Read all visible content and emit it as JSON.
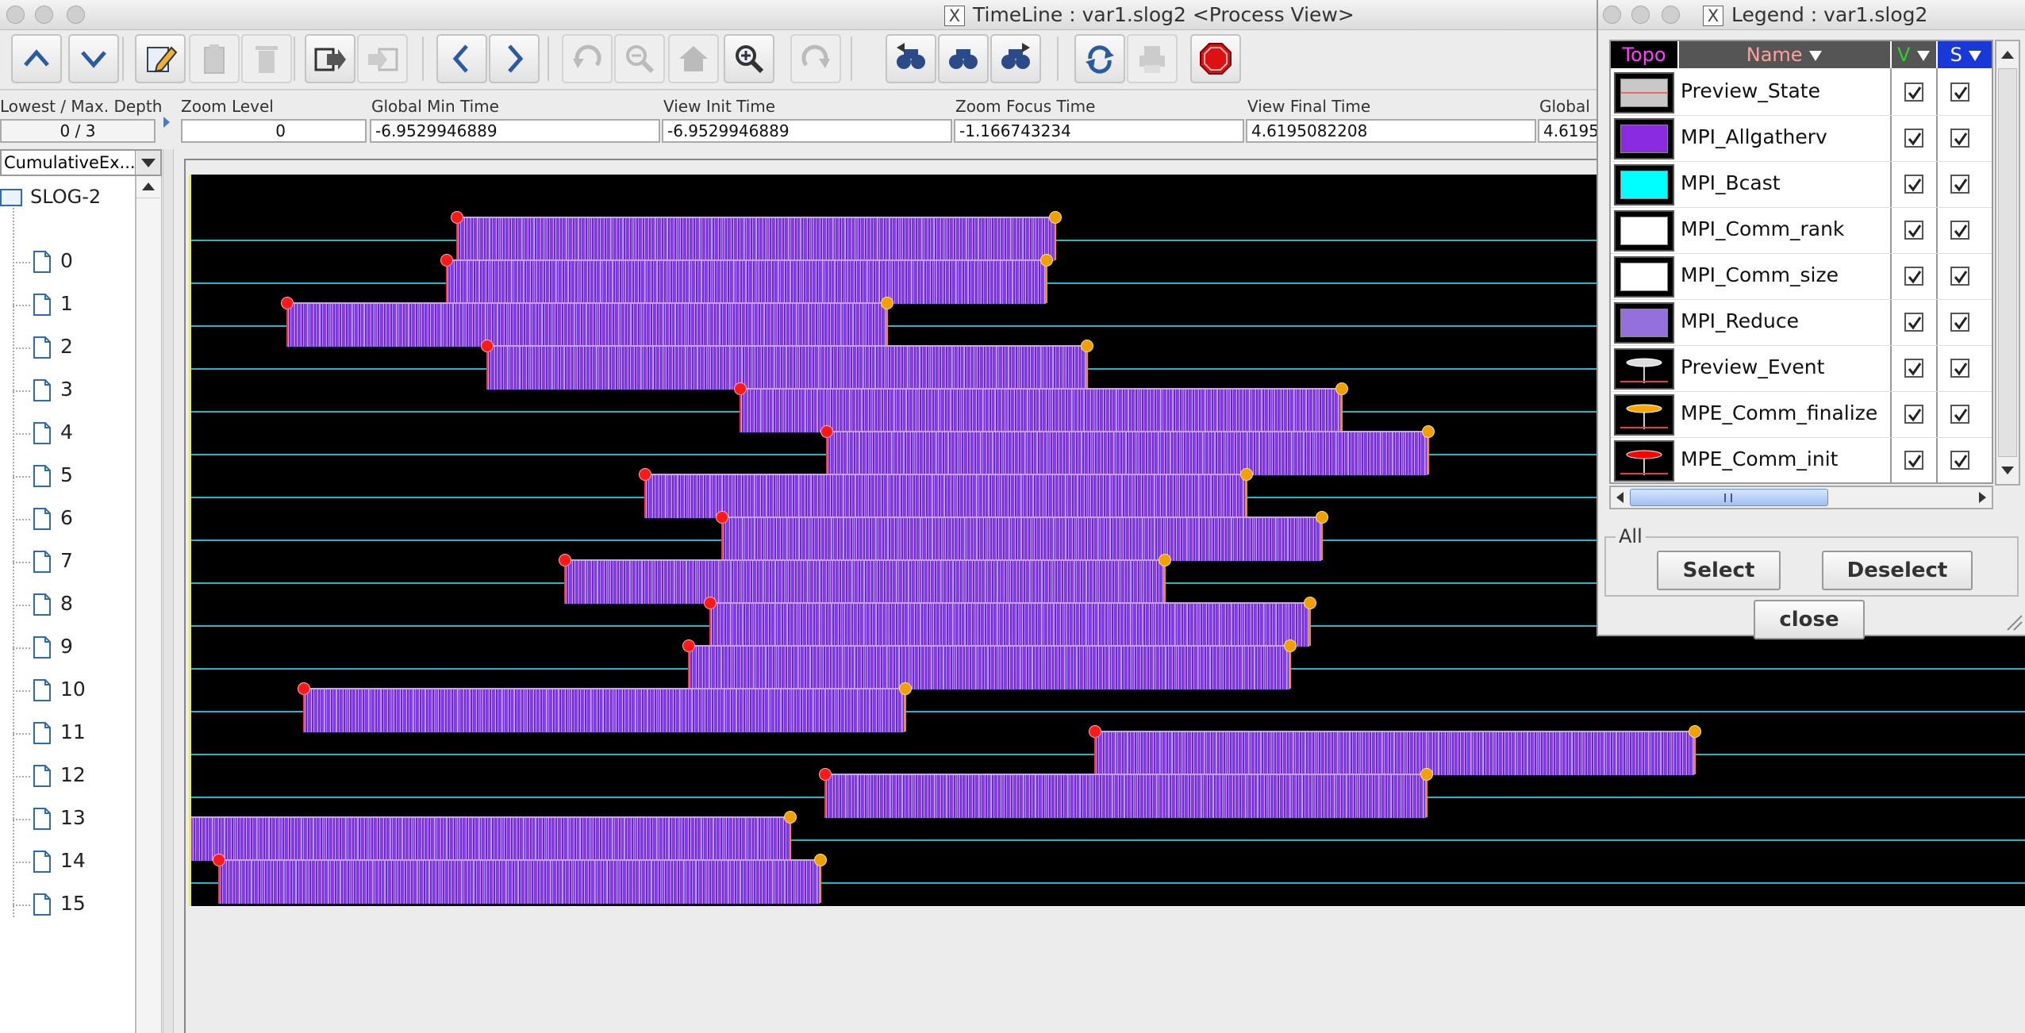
{
  "window": {
    "title": "TimeLine : var1.slog2  <Process View>"
  },
  "toolbar": {
    "buttons": [
      {
        "icon": "chevron-up-icon"
      },
      {
        "icon": "chevron-down-icon"
      },
      {
        "icon": "edit-pencil-icon"
      },
      {
        "icon": "clipboard-icon"
      },
      {
        "icon": "trash-icon"
      },
      {
        "icon": "export-icon"
      },
      {
        "icon": "import-icon"
      },
      {
        "icon": "chevron-left-icon"
      },
      {
        "icon": "chevron-right-icon"
      },
      {
        "icon": "undo-icon"
      },
      {
        "icon": "zoom-out-icon"
      },
      {
        "icon": "home-icon"
      },
      {
        "icon": "zoom-in-icon"
      },
      {
        "icon": "redo-icon"
      },
      {
        "icon": "search-backward-icon"
      },
      {
        "icon": "binoculars-icon"
      },
      {
        "icon": "search-forward-icon"
      },
      {
        "icon": "refresh-icon"
      },
      {
        "icon": "print-icon"
      },
      {
        "icon": "stop-icon"
      }
    ]
  },
  "fields": {
    "depth_label": "Lowest / Max. Depth",
    "depth_value": "0 / 3",
    "zoom_label": "Zoom Level",
    "zoom_value": "0",
    "global_min_label": "Global Min Time",
    "global_min_value": "-6.9529946889",
    "view_init_label": "View  Init Time",
    "view_init_value": "-6.9529946889",
    "zoom_focus_label": "Zoom Focus Time",
    "zoom_focus_value": "-1.166743234",
    "view_final_label": "View Final Time",
    "view_final_value": "4.6195082208",
    "global_max_label": "Global M",
    "global_max_value": "4.6195"
  },
  "combo": {
    "value": "CumulativeEx..."
  },
  "tree": {
    "root": "SLOG-2",
    "items": [
      "0",
      "1",
      "2",
      "3",
      "4",
      "5",
      "6",
      "7",
      "8",
      "9",
      "10",
      "11",
      "12",
      "13",
      "14",
      "15"
    ]
  },
  "timeline": {
    "rows": [
      {
        "rank": 0,
        "start": 0.159,
        "end": 0.518
      },
      {
        "rank": 1,
        "start": 0.153,
        "end": 0.513
      },
      {
        "rank": 2,
        "start": 0.057,
        "end": 0.417
      },
      {
        "rank": 3,
        "start": 0.177,
        "end": 0.537
      },
      {
        "rank": 4,
        "start": 0.329,
        "end": 0.69
      },
      {
        "rank": 5,
        "start": 0.381,
        "end": 0.742
      },
      {
        "rank": 6,
        "start": 0.272,
        "end": 0.633
      },
      {
        "rank": 7,
        "start": 0.318,
        "end": 0.678
      },
      {
        "rank": 8,
        "start": 0.224,
        "end": 0.584
      },
      {
        "rank": 9,
        "start": 0.311,
        "end": 0.671
      },
      {
        "rank": 10,
        "start": 0.298,
        "end": 0.659
      },
      {
        "rank": 11,
        "start": 0.067,
        "end": 0.428
      },
      {
        "rank": 12,
        "start": 0.542,
        "end": 0.902
      },
      {
        "rank": 13,
        "start": 0.38,
        "end": 0.741
      },
      {
        "rank": 14,
        "start": 0.0,
        "end": 0.359
      },
      {
        "rank": 15,
        "start": 0.016,
        "end": 0.377
      }
    ],
    "row_without_init_marker": 14
  },
  "legend": {
    "title": "Legend : var1.slog2",
    "col_topo": "Topo",
    "col_name": "Name",
    "col_v": "V",
    "col_s": "S",
    "items": [
      {
        "name": "Preview_State",
        "kind": "state",
        "color": "#c8c8c8"
      },
      {
        "name": "MPI_Allgatherv",
        "kind": "state",
        "color": "#8a2be2"
      },
      {
        "name": "MPI_Bcast",
        "kind": "state",
        "color": "#00ffff"
      },
      {
        "name": "MPI_Comm_rank",
        "kind": "state",
        "color": "#ffffff"
      },
      {
        "name": "MPI_Comm_size",
        "kind": "state",
        "color": "#ffffff"
      },
      {
        "name": "MPI_Reduce",
        "kind": "state",
        "color": "#9370db"
      },
      {
        "name": "Preview_Event",
        "kind": "event",
        "color": "#dddddd"
      },
      {
        "name": "MPE_Comm_finalize",
        "kind": "event",
        "color": "#ffa500"
      },
      {
        "name": "MPE_Comm_init",
        "kind": "event",
        "color": "#ff0000"
      }
    ],
    "group_label": "All",
    "select_label": "Select",
    "deselect_label": "Deselect",
    "close_label": "close"
  }
}
